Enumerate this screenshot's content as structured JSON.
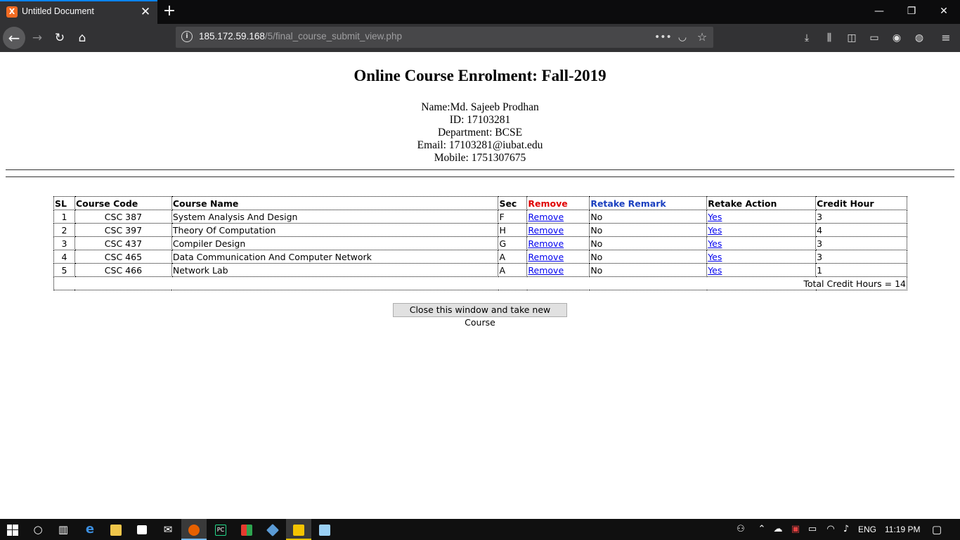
{
  "browser": {
    "tab_title": "Untitled Document",
    "favicon_letter": "X",
    "close_tab_glyph": "✕",
    "new_tab_glyph": "+",
    "url_host": "185.172.59.168",
    "url_path": "/5/final_course_submit_view.php",
    "window_controls": {
      "minimize": "—",
      "restore": "❐",
      "close": "✕"
    },
    "icons": {
      "back": "back-arrow-icon",
      "forward": "forward-arrow-icon",
      "reload": "reload-icon",
      "home": "home-icon",
      "info": "site-info-icon",
      "more": "page-actions-icon",
      "pocket": "pocket-icon",
      "bookmark": "bookmark-star-icon",
      "download": "download-icon",
      "library": "library-icon",
      "sidebar": "sidebar-icon",
      "screenshot": "screenshot-icon",
      "account": "account-icon",
      "globe": "globe-icon",
      "menu": "hamburger-menu-icon"
    }
  },
  "page": {
    "title": "Online Course Enrolment: Fall-2019",
    "student": {
      "name": "Name:Md. Sajeeb Prodhan",
      "id": "ID: 17103281",
      "department": "Department: BCSE",
      "email": "Email: 17103281@iubat.edu",
      "mobile": "Mobile: 1751307675"
    },
    "table": {
      "headers": {
        "sl": "SL",
        "code": "Course Code",
        "name": "Course Name",
        "sec": "Sec",
        "remove": "Remove",
        "retake_remark": "Retake Remark",
        "retake_action": "Retake Action",
        "credit": "Credit Hour"
      },
      "header_colors": {
        "remove": "#e00000",
        "retake_remark": "#1a3fbf"
      },
      "rows": [
        {
          "sl": "1",
          "code": "CSC 387",
          "name": "System Analysis And Design",
          "sec": "F",
          "remove": "Remove",
          "remark": "No",
          "action": "Yes",
          "credit": "3"
        },
        {
          "sl": "2",
          "code": "CSC 397",
          "name": "Theory Of Computation",
          "sec": "H",
          "remove": "Remove",
          "remark": "No",
          "action": "Yes",
          "credit": "4"
        },
        {
          "sl": "3",
          "code": "CSC 437",
          "name": "Compiler Design",
          "sec": "G",
          "remove": "Remove",
          "remark": "No",
          "action": "Yes",
          "credit": "3"
        },
        {
          "sl": "4",
          "code": "CSC 465",
          "name": "Data Communication And Computer Network",
          "sec": "A",
          "remove": "Remove",
          "remark": "No",
          "action": "Yes",
          "credit": "3"
        },
        {
          "sl": "5",
          "code": "CSC 466",
          "name": "Network Lab",
          "sec": "A",
          "remove": "Remove",
          "remark": "No",
          "action": "Yes",
          "credit": "1"
        }
      ],
      "total": "Total Credit Hours = 14"
    },
    "close_button": "Close this window and take new Course"
  },
  "taskbar": {
    "language": "ENG",
    "time": "11:19 PM",
    "apps": [
      "windows-start-icon",
      "cortana-icon",
      "task-view-icon",
      "edge-icon",
      "file-explorer-icon",
      "store-icon",
      "mail-icon",
      "firefox-icon",
      "pycharm-icon",
      "app-grid-icon",
      "virtualbox-icon",
      "media-player-icon",
      "notepad-icon"
    ]
  }
}
